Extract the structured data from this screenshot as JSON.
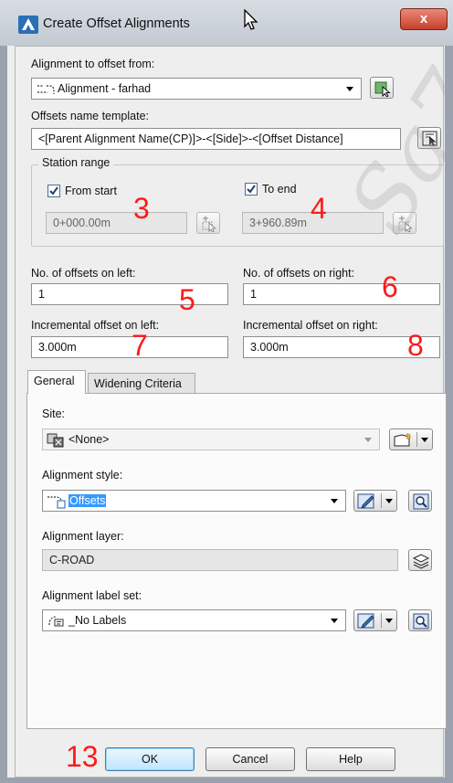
{
  "window": {
    "title": "Create Offset Alignments",
    "close_label": "x"
  },
  "alignment_from": {
    "label": "Alignment to offset from:",
    "value": "Alignment - farhad"
  },
  "name_template": {
    "label": "Offsets name template:",
    "value": "<[Parent Alignment Name(CP)]>-<[Side]>-<[Offset Distance]"
  },
  "station_range": {
    "legend": "Station range",
    "from_start_label": "From start",
    "from_start_checked": true,
    "from_start_value": "0+000.00m",
    "to_end_label": "To end",
    "to_end_checked": true,
    "to_end_value": "3+960.89m"
  },
  "offsets": {
    "left_count_label": "No. of offsets on left:",
    "left_count_value": "1",
    "right_count_label": "No. of offsets on right:",
    "right_count_value": "1",
    "left_inc_label": "Incremental offset on left:",
    "left_inc_value": "3.000m",
    "right_inc_label": "Incremental offset on right:",
    "right_inc_value": "3.000m"
  },
  "tabs": [
    {
      "label": "General",
      "active": true
    },
    {
      "label": "Widening Criteria",
      "active": false
    }
  ],
  "general": {
    "site_label": "Site:",
    "site_value": "<None>",
    "style_label": "Alignment style:",
    "style_value": "Offsets",
    "layer_label": "Alignment layer:",
    "layer_value": "C-ROAD",
    "labelset_label": "Alignment label set:",
    "labelset_value": "_No Labels"
  },
  "buttons": {
    "ok": "OK",
    "cancel": "Cancel",
    "help": "Help"
  },
  "annotations": {
    "n3": "3",
    "n4": "4",
    "n5": "5",
    "n6": "6",
    "n7": "7",
    "n8": "8",
    "n13": "13"
  },
  "watermark": "Sa7",
  "colors": {
    "annotation": "#ff1a1a",
    "selection": "#3399ff",
    "close_button": "#c7402a"
  }
}
